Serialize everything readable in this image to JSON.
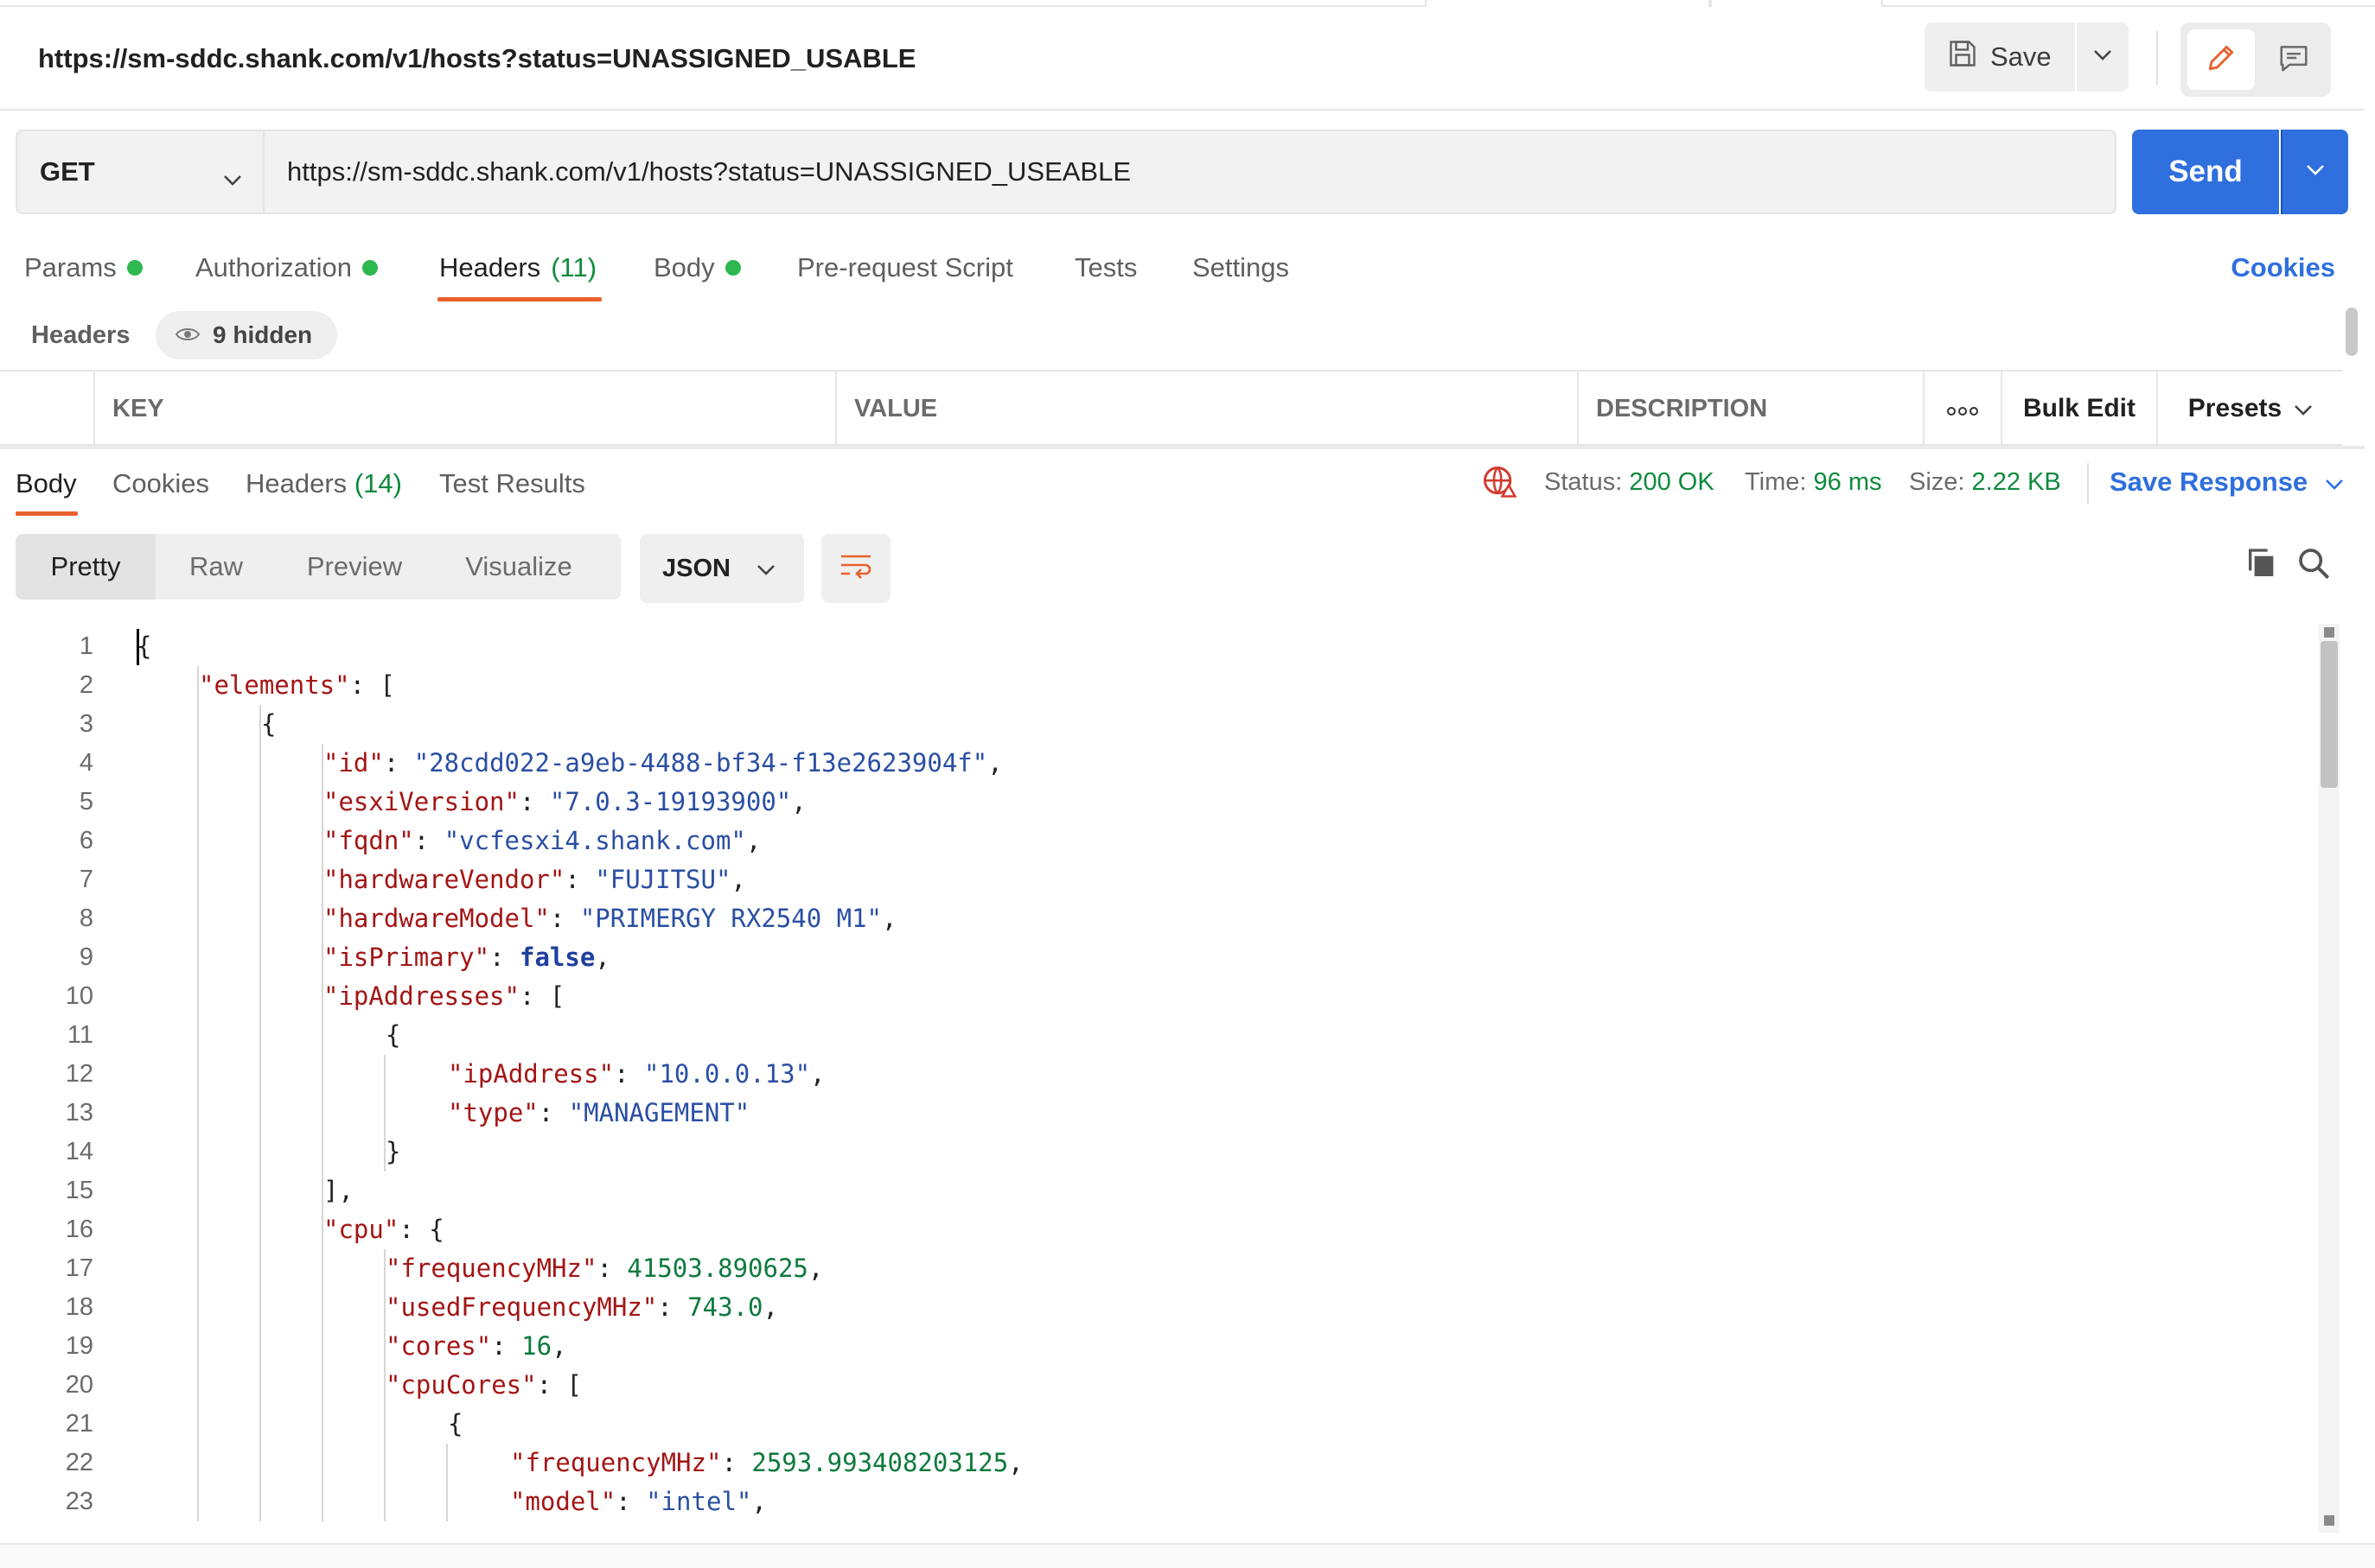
{
  "request": {
    "name": "https://sm-sddc.shank.com/v1/hosts?status=UNASSIGNED_USABLE",
    "save_label": "Save",
    "method": "GET",
    "url": "https://sm-sddc.shank.com/v1/hosts?status=UNASSIGNED_USEABLE",
    "send_label": "Send"
  },
  "request_tabs": {
    "params": "Params",
    "authorization": "Authorization",
    "headers": "Headers",
    "headers_count": "(11)",
    "body": "Body",
    "prerequest": "Pre-request Script",
    "tests": "Tests",
    "settings": "Settings",
    "cookies": "Cookies"
  },
  "headers_section": {
    "label": "Headers",
    "hidden": "9 hidden",
    "columns": {
      "key": "KEY",
      "value": "VALUE",
      "description": "DESCRIPTION",
      "bulk_edit": "Bulk Edit",
      "presets": "Presets"
    }
  },
  "response_tabs": {
    "body": "Body",
    "cookies": "Cookies",
    "headers": "Headers",
    "headers_count": "(14)",
    "test_results": "Test Results"
  },
  "response_status": {
    "status_label": "Status:",
    "status_value": "200 OK",
    "time_label": "Time:",
    "time_value": "96 ms",
    "size_label": "Size:",
    "size_value": "2.22 KB",
    "save_response": "Save Response"
  },
  "view_modes": {
    "pretty": "Pretty",
    "raw": "Raw",
    "preview": "Preview",
    "visualize": "Visualize",
    "format": "JSON"
  },
  "code_lines": [
    {
      "n": "1",
      "indent": 0,
      "parts": [
        [
          "p",
          "{"
        ]
      ]
    },
    {
      "n": "2",
      "indent": 1,
      "parts": [
        [
          "k",
          "\"elements\""
        ],
        [
          "p",
          ": ["
        ]
      ]
    },
    {
      "n": "3",
      "indent": 2,
      "parts": [
        [
          "p",
          "{"
        ]
      ]
    },
    {
      "n": "4",
      "indent": 3,
      "parts": [
        [
          "k",
          "\"id\""
        ],
        [
          "p",
          ": "
        ],
        [
          "s",
          "\"28cdd022-a9eb-4488-bf34-f13e2623904f\""
        ],
        [
          "p",
          ","
        ]
      ]
    },
    {
      "n": "5",
      "indent": 3,
      "parts": [
        [
          "k",
          "\"esxiVersion\""
        ],
        [
          "p",
          ": "
        ],
        [
          "s",
          "\"7.0.3-19193900\""
        ],
        [
          "p",
          ","
        ]
      ]
    },
    {
      "n": "6",
      "indent": 3,
      "parts": [
        [
          "k",
          "\"fqdn\""
        ],
        [
          "p",
          ": "
        ],
        [
          "s",
          "\"vcfesxi4.shank.com\""
        ],
        [
          "p",
          ","
        ]
      ]
    },
    {
      "n": "7",
      "indent": 3,
      "parts": [
        [
          "k",
          "\"hardwareVendor\""
        ],
        [
          "p",
          ": "
        ],
        [
          "s",
          "\"FUJITSU\""
        ],
        [
          "p",
          ","
        ]
      ]
    },
    {
      "n": "8",
      "indent": 3,
      "parts": [
        [
          "k",
          "\"hardwareModel\""
        ],
        [
          "p",
          ": "
        ],
        [
          "s",
          "\"PRIMERGY RX2540 M1\""
        ],
        [
          "p",
          ","
        ]
      ]
    },
    {
      "n": "9",
      "indent": 3,
      "parts": [
        [
          "k",
          "\"isPrimary\""
        ],
        [
          "p",
          ": "
        ],
        [
          "b",
          "false"
        ],
        [
          "p",
          ","
        ]
      ]
    },
    {
      "n": "10",
      "indent": 3,
      "parts": [
        [
          "k",
          "\"ipAddresses\""
        ],
        [
          "p",
          ": ["
        ]
      ]
    },
    {
      "n": "11",
      "indent": 4,
      "parts": [
        [
          "p",
          "{"
        ]
      ]
    },
    {
      "n": "12",
      "indent": 5,
      "parts": [
        [
          "k",
          "\"ipAddress\""
        ],
        [
          "p",
          ": "
        ],
        [
          "s",
          "\"10.0.0.13\""
        ],
        [
          "p",
          ","
        ]
      ]
    },
    {
      "n": "13",
      "indent": 5,
      "parts": [
        [
          "k",
          "\"type\""
        ],
        [
          "p",
          ": "
        ],
        [
          "s",
          "\"MANAGEMENT\""
        ]
      ]
    },
    {
      "n": "14",
      "indent": 4,
      "parts": [
        [
          "p",
          "}"
        ]
      ]
    },
    {
      "n": "15",
      "indent": 3,
      "parts": [
        [
          "p",
          "],"
        ]
      ]
    },
    {
      "n": "16",
      "indent": 3,
      "parts": [
        [
          "k",
          "\"cpu\""
        ],
        [
          "p",
          ": {"
        ]
      ]
    },
    {
      "n": "17",
      "indent": 4,
      "parts": [
        [
          "k",
          "\"frequencyMHz\""
        ],
        [
          "p",
          ": "
        ],
        [
          "n",
          "41503.890625"
        ],
        [
          "p",
          ","
        ]
      ]
    },
    {
      "n": "18",
      "indent": 4,
      "parts": [
        [
          "k",
          "\"usedFrequencyMHz\""
        ],
        [
          "p",
          ": "
        ],
        [
          "n",
          "743.0"
        ],
        [
          "p",
          ","
        ]
      ]
    },
    {
      "n": "19",
      "indent": 4,
      "parts": [
        [
          "k",
          "\"cores\""
        ],
        [
          "p",
          ": "
        ],
        [
          "n",
          "16"
        ],
        [
          "p",
          ","
        ]
      ]
    },
    {
      "n": "20",
      "indent": 4,
      "parts": [
        [
          "k",
          "\"cpuCores\""
        ],
        [
          "p",
          ": ["
        ]
      ]
    },
    {
      "n": "21",
      "indent": 5,
      "parts": [
        [
          "p",
          "{"
        ]
      ]
    },
    {
      "n": "22",
      "indent": 6,
      "parts": [
        [
          "k",
          "\"frequencyMHz\""
        ],
        [
          "p",
          ": "
        ],
        [
          "n",
          "2593.993408203125"
        ],
        [
          "p",
          ","
        ]
      ]
    },
    {
      "n": "23",
      "indent": 6,
      "parts": [
        [
          "k",
          "\"model\""
        ],
        [
          "p",
          ": "
        ],
        [
          "s",
          "\"intel\""
        ],
        [
          "p",
          ","
        ]
      ]
    }
  ],
  "icons": {
    "save": "floppy-disk-icon",
    "edit": "pencil-icon",
    "comment": "comment-icon",
    "eye": "eye-icon",
    "more": "more-icon",
    "wrap": "wrap-lines-icon",
    "copy": "copy-icon",
    "search": "search-icon",
    "network": "globe-warning-icon"
  },
  "colors": {
    "accent": "#2f6fde",
    "tab_underline": "#e8612c",
    "success": "#0f8a3c",
    "dot": "#2eb84f",
    "json_key": "#a31515",
    "json_string": "#2a4fa3",
    "json_number": "#0e7a3d"
  }
}
